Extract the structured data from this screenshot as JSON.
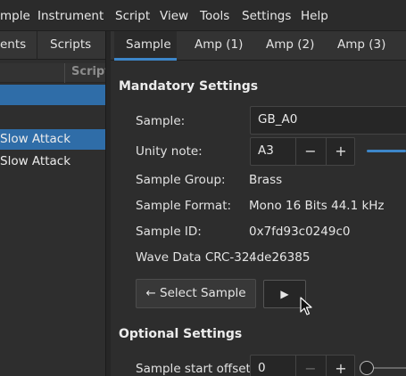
{
  "menu": [
    "mple",
    "Instrument",
    "Script",
    "View",
    "Tools",
    "Settings",
    "Help"
  ],
  "left_panel": {
    "tabs": [
      "ents",
      "Scripts"
    ],
    "column_header": "Script",
    "rows": [
      {
        "label": "",
        "selected": true
      },
      {
        "label": "",
        "selected": false
      },
      {
        "label": "Slow Attack",
        "selected": true
      },
      {
        "label": "Slow Attack",
        "selected": false
      }
    ]
  },
  "right_panel": {
    "tabs": [
      "Sample",
      "Amp (1)",
      "Amp (2)",
      "Amp (3)"
    ],
    "active_tab": "Sample",
    "mandatory": {
      "title": "Mandatory Settings",
      "sample_label": "Sample:",
      "sample_value": "GB_A0",
      "unity_label": "Unity note:",
      "unity_value": "A3",
      "group_label": "Sample Group:",
      "group_value": "Brass",
      "format_label": "Sample Format:",
      "format_value": "Mono 16 Bits 44.1 kHz",
      "id_label": "Sample ID:",
      "id_value": "0x7fd93c0249c0",
      "crc_label": "Wave Data CRC-32:",
      "crc_value": "4de26385",
      "select_button": "← Select Sample",
      "play_button": "▶"
    },
    "optional": {
      "title": "Optional Settings",
      "start_offset_label": "Sample start offset:",
      "start_offset_value": "0"
    }
  },
  "stepper": {
    "minus": "−",
    "plus": "+"
  },
  "colors": {
    "accent": "#3d86c9",
    "selection": "#2f6da8",
    "background": "#2d2d2d"
  },
  "icons": {
    "play": "play-icon",
    "cursor": "mouse-cursor-icon"
  }
}
